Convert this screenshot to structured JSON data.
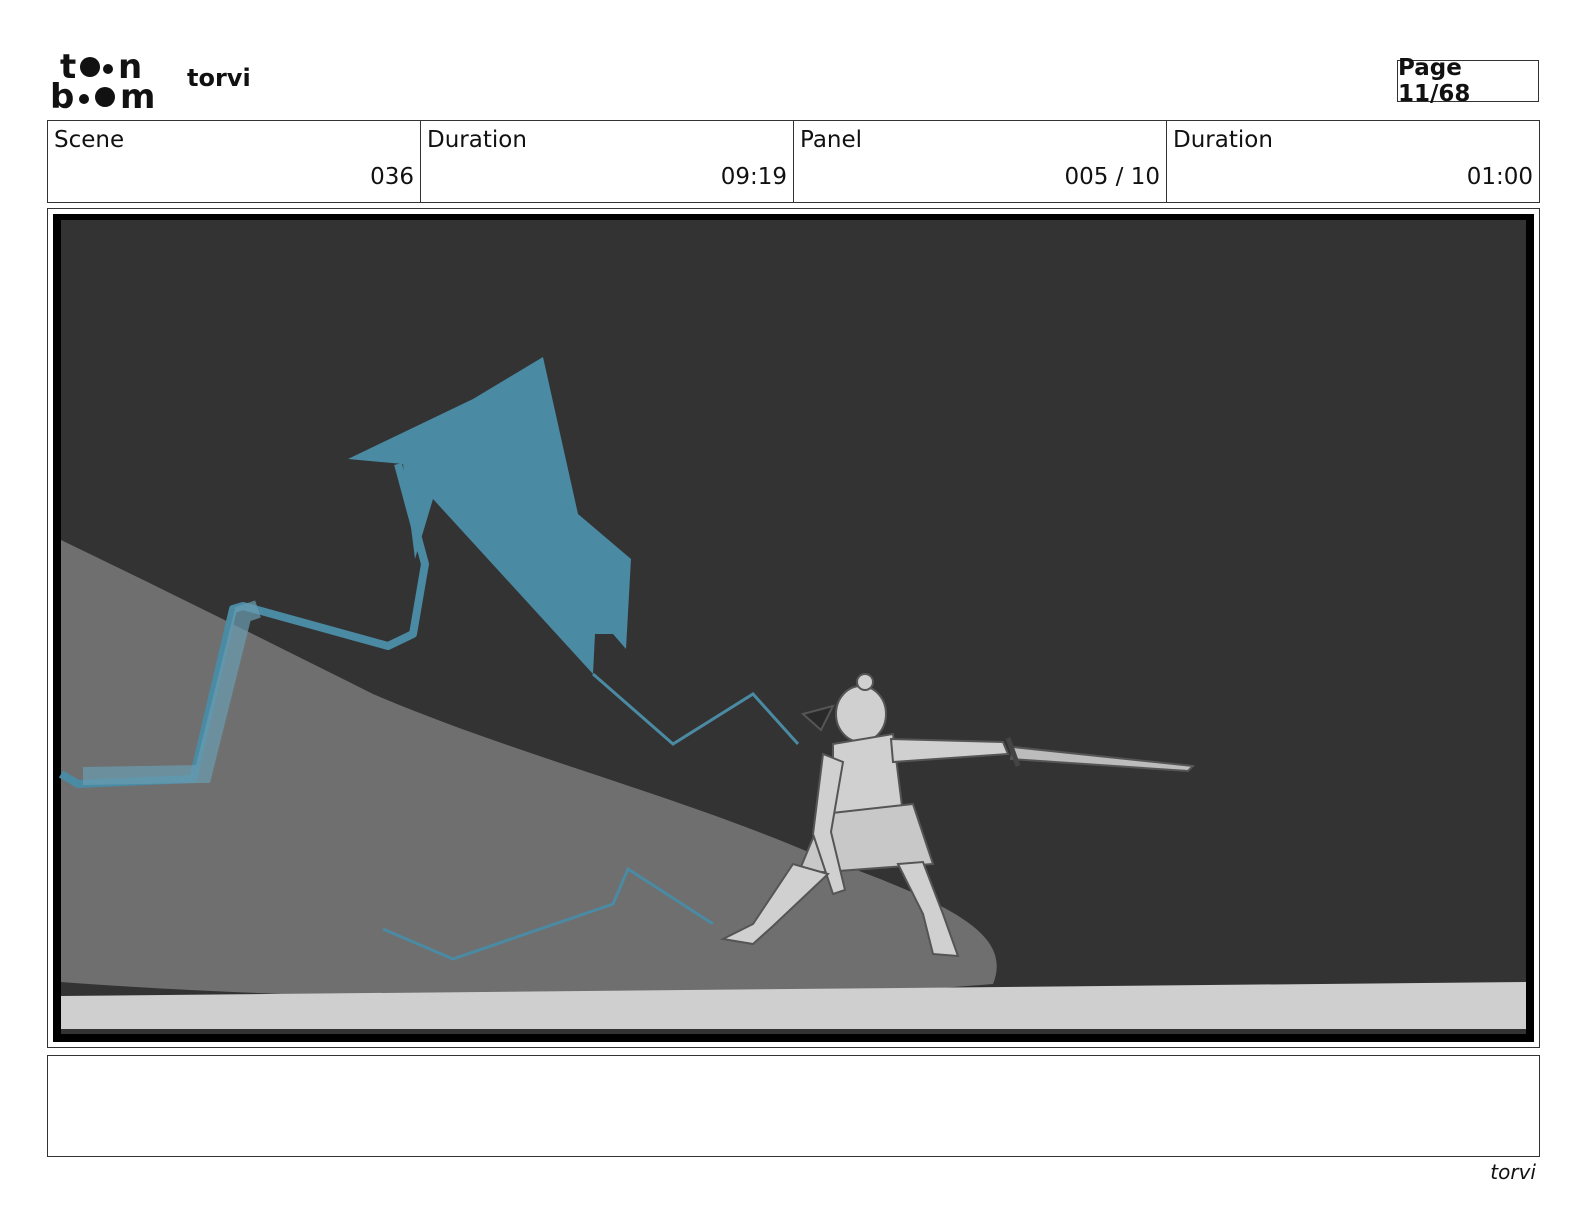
{
  "header": {
    "logo_text": "toon boom",
    "project": "torvi",
    "page": "Page 11/68"
  },
  "info": {
    "scene_label": "Scene",
    "scene_value": "036",
    "duration_label": "Duration",
    "duration_value": "09:19",
    "panel_label": "Panel",
    "panel_value": "005 / 10",
    "panel_duration_label": "Duration",
    "panel_duration_value": "01:00"
  },
  "panel": {
    "image_semantic": "storyboard-sketch-warrior-with-sword",
    "colors": {
      "sky": "#333333",
      "hill": "#6f6f6f",
      "ground": "#cfcfcf",
      "magic": "#4a8aa3"
    }
  },
  "notes": {
    "text": ""
  },
  "footer": {
    "project": "torvi"
  }
}
